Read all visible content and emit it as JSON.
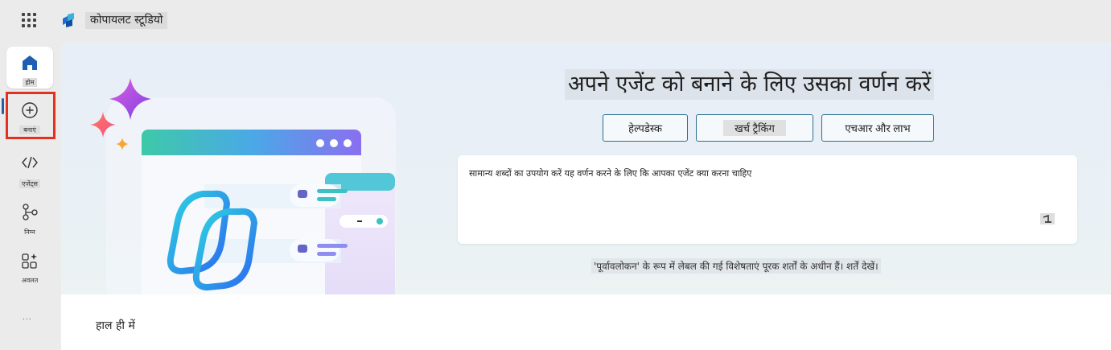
{
  "app": {
    "title": "कोपायलट स्टूडियो",
    "accent": "#2a5ba8",
    "highlight_color": "#e5301d"
  },
  "rail": {
    "items": [
      {
        "label": "होम",
        "icon": "home-icon"
      },
      {
        "label": "बनाएं",
        "icon": "plus-circle-icon"
      },
      {
        "label": "एजेंट्स",
        "icon": "agent-icon"
      },
      {
        "label": "निम्न",
        "icon": "flow-icon"
      },
      {
        "label": "अवलत",
        "icon": "tools-icon"
      },
      {
        "label": "...",
        "icon": "more-icon"
      }
    ]
  },
  "hero": {
    "heading": "अपने एजेंट को बनाने के लिए उसका वर्णन करें",
    "chips": [
      "हेल्पडेस्क",
      "खर्च ट्रैकिंग",
      "एचआर और लाभ"
    ],
    "prompt_placeholder": "सामान्य शब्दों का उपयोग करें यह वर्णन करने के लिए कि आपका एजेंट क्या करना चाहिए",
    "disclaimer": "'पूर्वावलोकन' के रूप में लेबल की गई विशेषताएं पूरक शर्तों के अधीन हैं। शर्तें देखें।"
  },
  "recent": {
    "label": "हाल ही में"
  }
}
